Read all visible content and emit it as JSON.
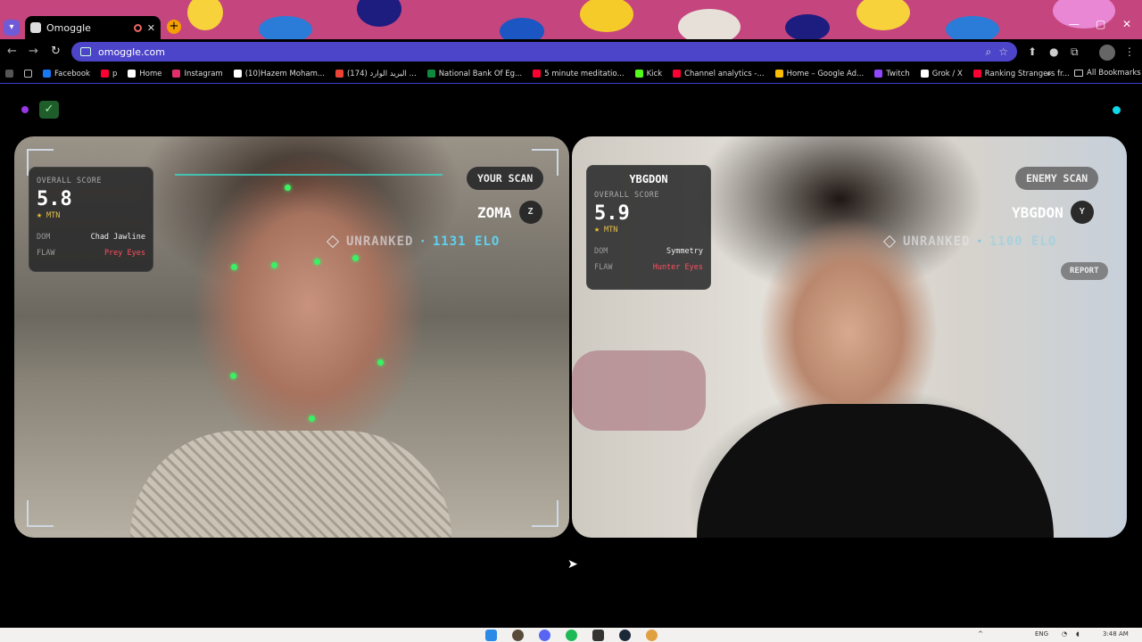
{
  "browser": {
    "tab_title": "Omoggle",
    "tab_close": "✕",
    "new_tab": "+",
    "url": "omoggle.com",
    "window_controls": {
      "minimize": "—",
      "maximize": "▢",
      "close": "✕"
    },
    "nav": {
      "back": "←",
      "forward": "→",
      "reload": "↻"
    }
  },
  "bookmarks": [
    {
      "label": "Facebook",
      "color": "#1877f2"
    },
    {
      "label": "p",
      "color": "#ff0033"
    },
    {
      "label": "Home",
      "color": "#ffffff"
    },
    {
      "label": "Instagram",
      "color": "#e1306c"
    },
    {
      "label": "(10)Hazem Moham...",
      "color": "#ffffff"
    },
    {
      "label": "(174) البريد الوارد ...",
      "color": "#ea4335"
    },
    {
      "label": "National Bank Of Eg...",
      "color": "#0f8a3c"
    },
    {
      "label": "5 minute meditatio...",
      "color": "#ff0033"
    },
    {
      "label": "Kick",
      "color": "#53fc18"
    },
    {
      "label": "Channel analytics -...",
      "color": "#ff0033"
    },
    {
      "label": "Home – Google Ad...",
      "color": "#fbbc04"
    },
    {
      "label": "Twitch",
      "color": "#9146ff"
    },
    {
      "label": "Grok / X",
      "color": "#ffffff"
    },
    {
      "label": "Ranking Strangers fr...",
      "color": "#ff0033"
    }
  ],
  "bookmarks_more": "»",
  "bookmarks_all": "All Bookmarks",
  "page": {
    "check_label": "✓",
    "you": {
      "overall_label": "OVERALL SCORE",
      "score": "5.8",
      "tier": "MTN",
      "dom_label": "DOM",
      "dom_value": "Chad Jawline",
      "flaw_label": "FLAW",
      "flaw_value": "Prey Eyes",
      "scan_label": "YOUR SCAN",
      "name": "ZOMA",
      "avatar_letter": "Z",
      "rank": "UNRANKED",
      "separator": "·",
      "elo": "1131 ELO"
    },
    "enemy": {
      "name_title": "YBGDON",
      "overall_label": "OVERALL SCORE",
      "score": "5.9",
      "tier": "MTN",
      "dom_label": "DOM",
      "dom_value": "Symmetry",
      "flaw_label": "FLAW",
      "flaw_value": "Hunter Eyes",
      "scan_label": "ENEMY SCAN",
      "name": "YBGDON",
      "avatar_letter": "Y",
      "rank": "UNRANKED",
      "separator": "·",
      "elo": "1100 ELO",
      "report_label": "REPORT"
    }
  },
  "taskbar": {
    "language": "ENG",
    "time": "3:48 AM"
  },
  "colors": {
    "accent_green": "#3cf064",
    "elo_blue": "#5fd1f0",
    "flaw_red": "#ff4d5f",
    "omnibox": "#4c44c9"
  }
}
